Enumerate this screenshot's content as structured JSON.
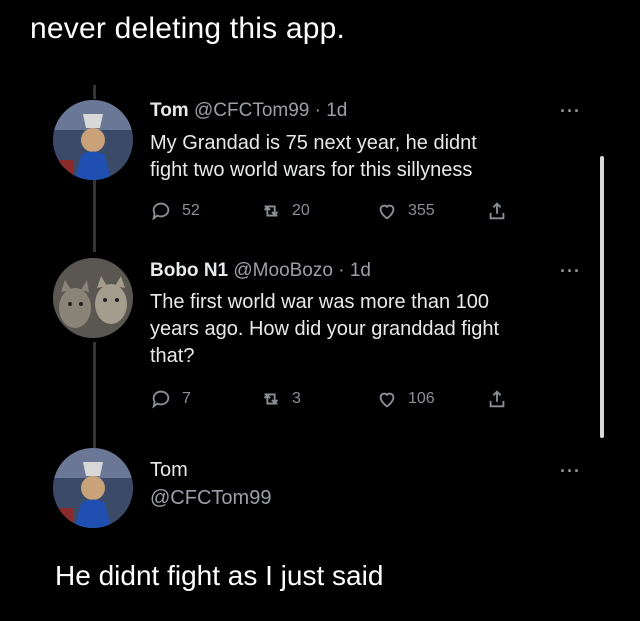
{
  "caption": "never deleting this app.",
  "tweets": [
    {
      "name": "Tom",
      "meta": "@CFCTom99 · 1d",
      "lines": [
        "My Grandad is 75 next year,  he didnt",
        "fight two world wars for this sillyness"
      ],
      "more": "···",
      "replies": "52",
      "retweets": "20",
      "likes": "355"
    },
    {
      "name": "Bobo N1",
      "meta": "@MooBozo · 1d",
      "lines": [
        "The first world war was more than 100",
        "years ago. How did your granddad fight",
        "that?"
      ],
      "more": "···",
      "replies": "7",
      "retweets": "3",
      "likes": "106"
    }
  ],
  "reply": {
    "name": "Tom",
    "handle": "@CFCTom99",
    "more": "···",
    "text": "He didnt fight as I just said"
  },
  "icons": {
    "reply": "reply-icon",
    "retweet": "retweet-icon",
    "like": "heart-icon",
    "share": "share-icon"
  },
  "colors": {
    "background": "#000000",
    "text": "#e7e9ea",
    "muted": "#8b9096"
  }
}
